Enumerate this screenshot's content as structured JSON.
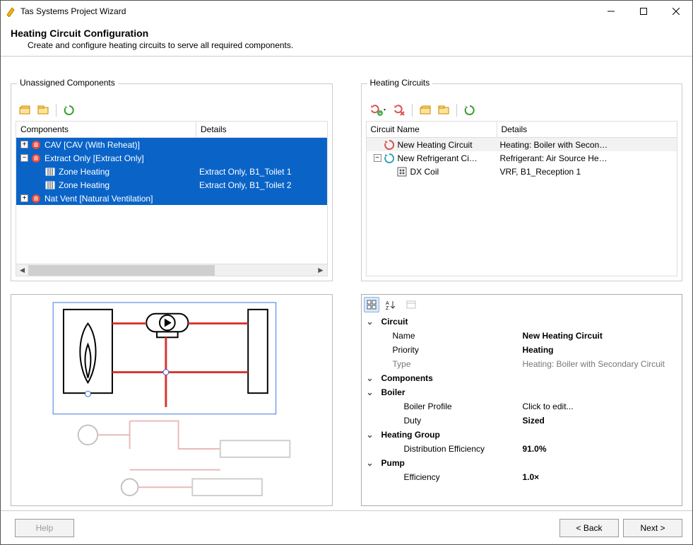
{
  "window": {
    "title": "Tas Systems Project Wizard"
  },
  "header": {
    "title": "Heating Circuit Configuration",
    "subtitle": "Create and configure heating circuits to serve all required components."
  },
  "unassigned": {
    "legend": "Unassigned Components",
    "cols": {
      "c1": "Components",
      "c2": "Details"
    },
    "rows": [
      {
        "depth": 0,
        "exp": "+",
        "icon": "hand",
        "label": "CAV [CAV (With Reheat)]",
        "detail": ""
      },
      {
        "depth": 0,
        "exp": "-",
        "icon": "hand",
        "label": "Extract Only [Extract Only]",
        "detail": ""
      },
      {
        "depth": 1,
        "icon": "zone",
        "label": "Zone Heating",
        "detail": "Extract Only, B1_Toilet 1"
      },
      {
        "depth": 1,
        "icon": "zone",
        "label": "Zone Heating",
        "detail": "Extract Only, B1_Toilet 2"
      },
      {
        "depth": 0,
        "exp": "+",
        "icon": "hand",
        "label": "Nat Vent [Natural Ventilation]",
        "detail": ""
      }
    ]
  },
  "circuits": {
    "legend": "Heating Circuits",
    "cols": {
      "c1": "Circuit Name",
      "c2": "Details"
    },
    "rows": [
      {
        "depth": 0,
        "icon": "cyc-red",
        "label": "New Heating Circuit",
        "detail": "Heating:  Boiler  with Secon…",
        "selected": true
      },
      {
        "depth": 0,
        "exp": "-",
        "icon": "cyc-blue",
        "label": "New Refrigerant Ci…",
        "detail": "Refrigerant: Air Source He…"
      },
      {
        "depth": 1,
        "icon": "dx",
        "label": "DX Coil",
        "detail": "VRF, B1_Reception 1"
      }
    ]
  },
  "props": {
    "groups": [
      {
        "cat": "Circuit",
        "rows": [
          {
            "k": "Name",
            "v": "New Heating Circuit",
            "bold": true
          },
          {
            "k": "Priority",
            "v": "Heating",
            "bold": true
          },
          {
            "k": "Type",
            "v": "Heating: Boiler with Secondary Circuit",
            "gray": true
          }
        ]
      },
      {
        "cat": "Components",
        "rows": []
      },
      {
        "cat": "Boiler",
        "rows": [
          {
            "k": "Boiler Profile",
            "v": "Click to edit...",
            "sub": true
          },
          {
            "k": "Duty",
            "v": "Sized",
            "sub": true,
            "bold": true
          }
        ]
      },
      {
        "cat": "Heating Group",
        "rows": [
          {
            "k": "Distribution Efficiency",
            "v": "91.0%",
            "sub": true,
            "bold": true
          }
        ]
      },
      {
        "cat": "Pump",
        "rows": [
          {
            "k": "Efficiency",
            "v": "1.0×",
            "sub": true,
            "bold": true
          }
        ]
      }
    ]
  },
  "footer": {
    "help": "Help",
    "back": "< Back",
    "next": "Next >"
  },
  "icons": {
    "folder_open": "folder-open-icon",
    "folder": "folder-icon",
    "refresh": "refresh-icon",
    "add_circ": "add-circuit-icon",
    "del_circ": "delete-circuit-icon"
  }
}
